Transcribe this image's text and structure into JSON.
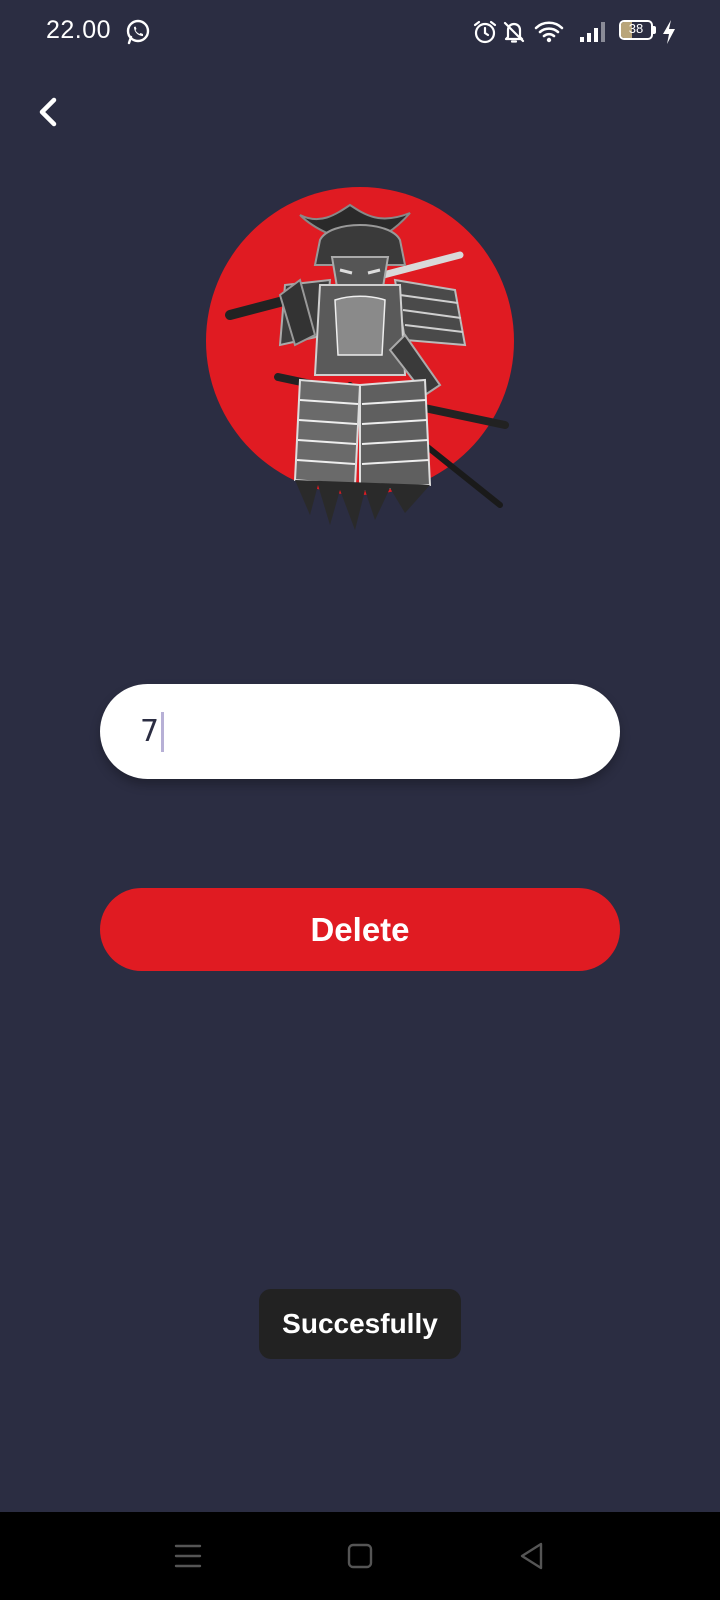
{
  "status_bar": {
    "time": "22.00",
    "battery_level": "38",
    "battery_fraction": 0.38,
    "icons": [
      "whatsapp-icon",
      "alarm-icon",
      "mute-bell-icon",
      "wifi-icon",
      "signal-icon",
      "battery-icon",
      "charging-icon"
    ]
  },
  "header": {
    "back_icon": "chevron-left-icon"
  },
  "hero": {
    "image": "samurai-illustration",
    "circle_color": "#e01b22"
  },
  "form": {
    "input_value": "7",
    "delete_label": "Delete"
  },
  "toast": {
    "message": "Succesfully"
  },
  "nav_bar": {
    "icons": [
      "menu-icon",
      "home-icon",
      "back-triangle-icon"
    ]
  },
  "colors": {
    "background": "#2b2d42",
    "accent": "#e01b22",
    "toast": "#222222"
  }
}
